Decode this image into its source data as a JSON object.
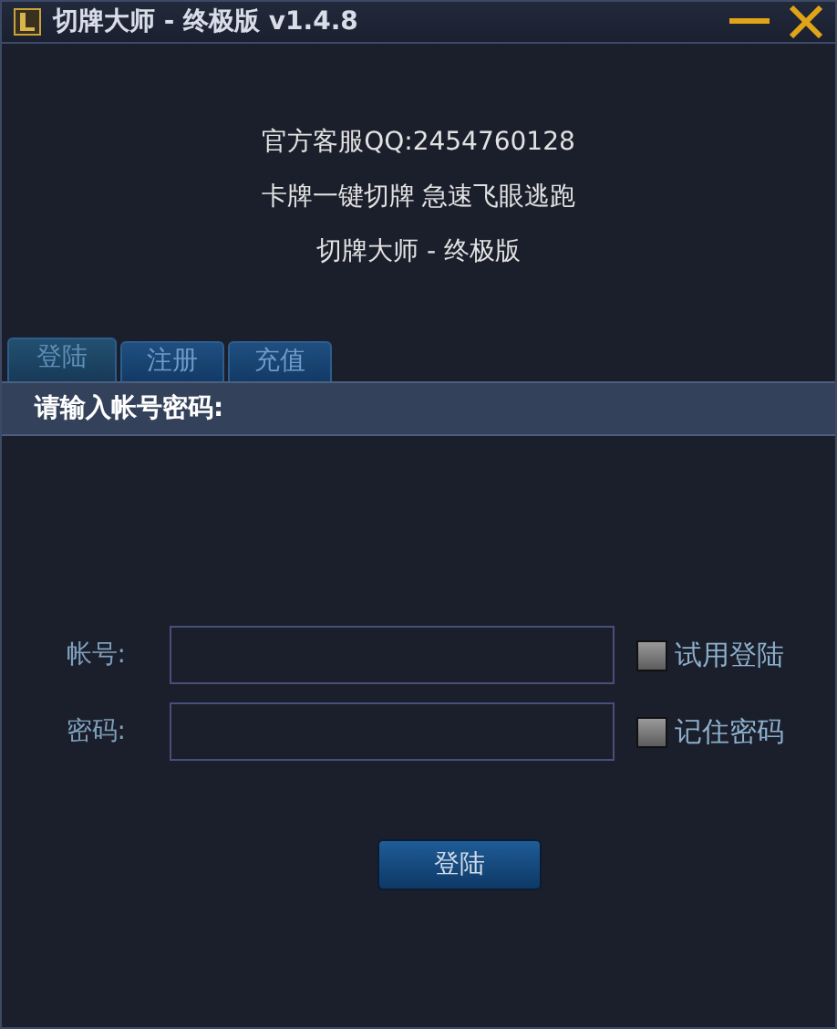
{
  "window": {
    "title": "切牌大师 - 终极版 v1.4.8"
  },
  "info_lines": [
    "官方客服QQ:2454760128",
    "卡牌一键切牌 急速飞眼逃跑",
    "切牌大师 - 终极版"
  ],
  "tabs": [
    {
      "label": "登陆",
      "selected": true
    },
    {
      "label": "注册",
      "selected": false
    },
    {
      "label": "充值",
      "selected": false
    }
  ],
  "section_header": "请输入帐号密码:",
  "fields": [
    {
      "label": "帐号:",
      "option": {
        "label": "试用登陆",
        "checked": false
      }
    },
    {
      "label": "密码:",
      "option": {
        "label": "记住密码",
        "checked": false
      }
    }
  ],
  "submit_button": "登陆"
}
